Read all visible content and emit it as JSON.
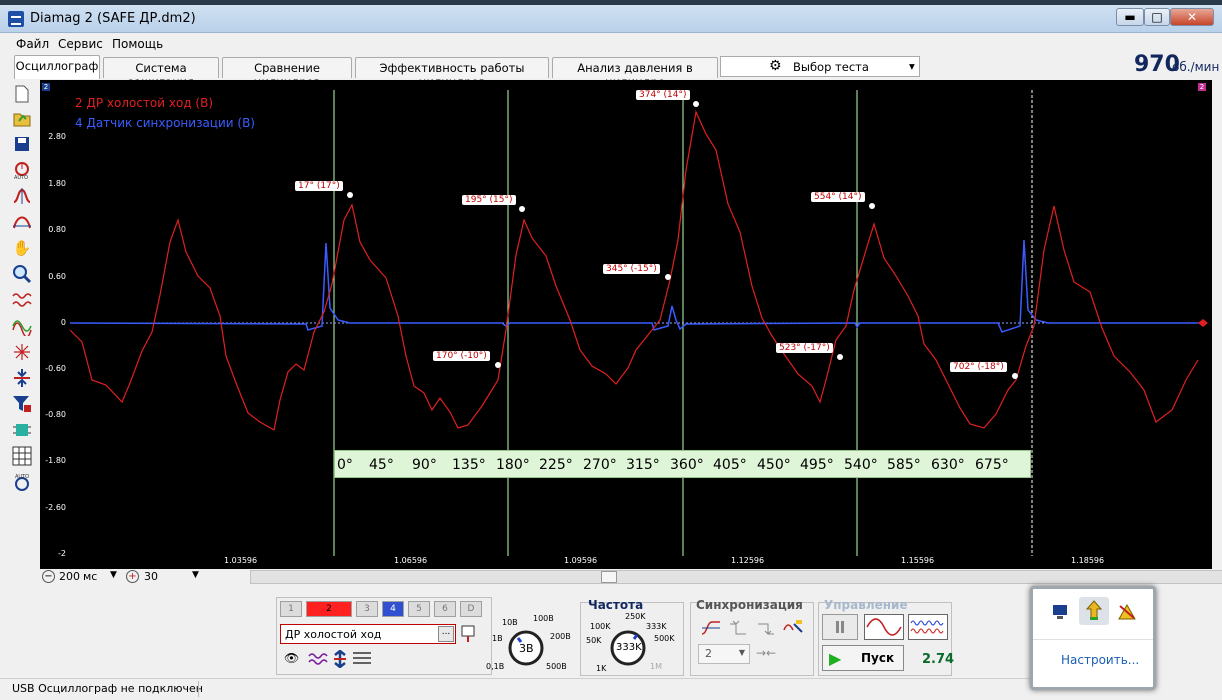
{
  "window": {
    "title": "Diamag 2 (SAFE ДР.dm2)",
    "minimize": "▬",
    "maximize": "□",
    "close": "✕"
  },
  "menu": [
    "Файл",
    "Сервис",
    "Помощь"
  ],
  "tabs": [
    {
      "label": "Осциллограф",
      "active": true
    },
    {
      "label": "Система зажигания",
      "active": false
    },
    {
      "label": "Сравнение цилиндров",
      "active": false
    },
    {
      "label": "Эффективность работы цилиндров",
      "active": false
    },
    {
      "label": "Анализ давления в цилиндре",
      "active": false
    }
  ],
  "test_select": {
    "label": "Выбор теста",
    "arrow": "▾"
  },
  "rpm": {
    "value": "970",
    "unit": "об./мин"
  },
  "tools": [
    "new-icon",
    "open-icon",
    "save-icon",
    "auto-scale-icon",
    "cursor-icon",
    "sine-icon",
    "hand-icon",
    "zoom-icon",
    "filter-icon",
    "measure-icon",
    "sync-icon",
    "split-icon",
    "channel-icon",
    "chip-icon",
    "grid-icon",
    "auto-icon"
  ],
  "plot": {
    "channel_marker_left": "2",
    "channel_marker_right": "2",
    "y_ticks": [
      "2.80",
      "1.80",
      "0.80",
      "0.60",
      "0",
      "-0.60",
      "-0.80",
      "-1.80",
      "-2.60",
      "-2"
    ],
    "x_ticks": [
      "1.03596",
      "1.06596",
      "1.09596",
      "1.12596",
      "1.15596",
      "1.18596"
    ],
    "legend": [
      {
        "label": "2 ДР холостой ход (В)",
        "color": "#e02020"
      },
      {
        "label": "4 Датчик синхронизации (В)",
        "color": "#3a5cff"
      }
    ],
    "cursor_labels": [
      "17° (17°)",
      "195° (15°)",
      "374° (14°)",
      "554° (14°)",
      "345° (-15°)",
      "170° (-10°)",
      "523° (-17°)",
      "702° (-18°)"
    ],
    "degrees": [
      "0°",
      "45°",
      "90°",
      "135°",
      "180°",
      "225°",
      "270°",
      "315°",
      "360°",
      "405°",
      "450°",
      "495°",
      "540°",
      "585°",
      "630°",
      "675°"
    ]
  },
  "zoom": {
    "time_value": "200",
    "time_unit": "мс",
    "amp_value": "30"
  },
  "channels": {
    "buttons": [
      "1",
      "2",
      "3",
      "4",
      "5",
      "6",
      "D"
    ],
    "name": "ДР холостой ход",
    "name_more": "...",
    "volt_knob": {
      "value": "3В",
      "labels": [
        "10В",
        "100В",
        "1В",
        "200В",
        "0,1В",
        "500В"
      ]
    }
  },
  "frequency": {
    "title": "Частота",
    "value": "333K",
    "labels": [
      "250K",
      "100K",
      "333K",
      "500K",
      "50K",
      "1K",
      "1M"
    ]
  },
  "sync": {
    "title": "Синхронизация",
    "channel": "2"
  },
  "control": {
    "title": "Управление",
    "start_label": "Пуск",
    "value": "2.74"
  },
  "status": {
    "text": "USB Осциллограф не подключен"
  },
  "tray_popup": {
    "link": "Настроить..."
  }
}
